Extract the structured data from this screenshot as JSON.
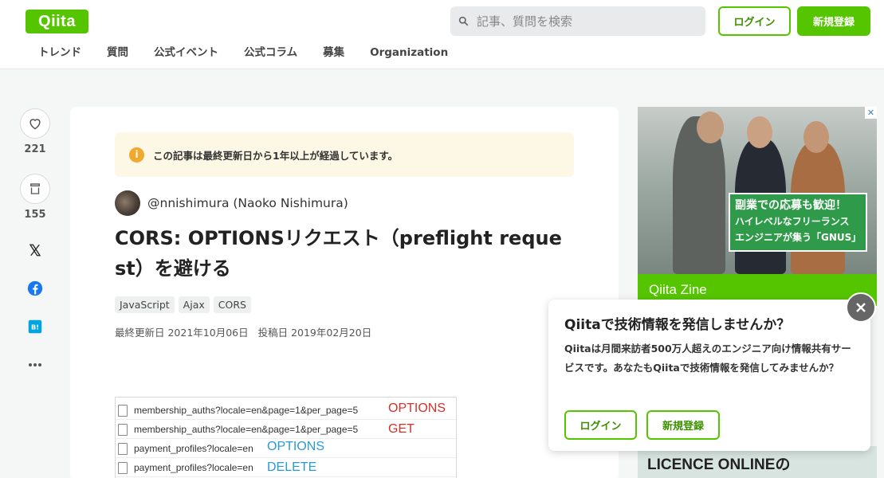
{
  "header": {
    "logo": "Qiita",
    "search_placeholder": "記事、質問を検索",
    "login_label": "ログイン",
    "signup_label": "新規登録",
    "nav": [
      "トレンド",
      "質問",
      "公式イベント",
      "公式コラム",
      "募集",
      "Organization"
    ]
  },
  "share": {
    "like_count": "221",
    "stock_count": "155",
    "icons": [
      "heart-icon",
      "stock-icon",
      "x-icon",
      "facebook-icon",
      "hatena-bookmark-icon",
      "more-icon"
    ]
  },
  "article": {
    "notice": "この記事は最終更新日から1年以上が経過しています。",
    "author": "@nnishimura (Naoko Nishimura)",
    "title_line1": "CORS: OPTIONSリクエスト（preflight reque",
    "title_line2": "st）を避ける",
    "tags": [
      "JavaScript",
      "Ajax",
      "CORS"
    ],
    "updated": "最終更新日 2021年10月06日",
    "posted": "投稿日 2019年02月20日",
    "screenshot_rows": [
      {
        "file": "membership_auths?locale=en&page=1&per_page=5",
        "method": "OPTIONS"
      },
      {
        "file": "membership_auths?locale=en&page=1&per_page=5",
        "method": "GET"
      },
      {
        "file": "payment_profiles?locale=en",
        "method": "OPTIONS"
      },
      {
        "file": "payment_profiles?locale=en",
        "method": "DELETE"
      }
    ]
  },
  "ad": {
    "badge_line1": "副業での応募も歓迎！",
    "badge_line2": "ハイレベルなフリーランス",
    "badge_line3": "エンジニアが集う「GNUS」",
    "footer": "Qiita Zine",
    "second_text": "LICENCE ONLINEの"
  },
  "popup": {
    "title": "Qiitaで技術情報を発信しませんか？",
    "body": "Qiitaは月間来訪者500万人超えのエンジニア向け情報共有サービスです。あなたもQiitaで技術情報を発信してみませんか？",
    "login_label": "ログイン",
    "signup_label": "新規登録"
  },
  "colors": {
    "brand": "#55c500",
    "notice_bg": "#fdf7e6",
    "method_red": "#d0322a",
    "method_blue": "#2a9ad5"
  }
}
